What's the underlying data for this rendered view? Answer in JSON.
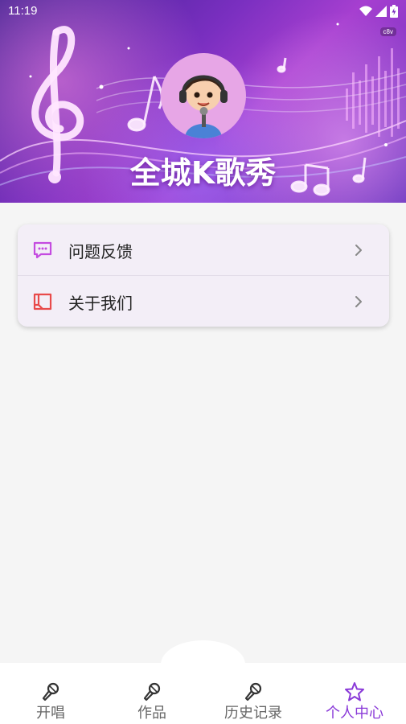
{
  "status_bar": {
    "time": "11:19"
  },
  "hero": {
    "build_badge": "c8v",
    "title": "全城K歌秀"
  },
  "menu": {
    "items": [
      {
        "label": "问题反馈",
        "icon": "feedback-chat-icon",
        "icon_color": "#c44be0"
      },
      {
        "label": "关于我们",
        "icon": "about-book-icon",
        "icon_color": "#e84a4a"
      }
    ]
  },
  "bottom_nav": {
    "items": [
      {
        "label": "开唱",
        "icon": "microphone-icon",
        "active": false
      },
      {
        "label": "作品",
        "icon": "microphone-icon",
        "active": false
      },
      {
        "label": "历史记录",
        "icon": "microphone-icon",
        "active": false
      },
      {
        "label": "个人中心",
        "icon": "star-icon",
        "active": true
      }
    ],
    "active_color": "#8a3ad8"
  }
}
